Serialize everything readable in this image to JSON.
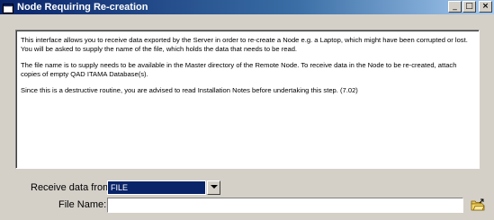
{
  "window": {
    "title": "Node Requiring Re-creation",
    "buttons": {
      "minimize": "_",
      "maximize": "□",
      "close": "×"
    }
  },
  "description": {
    "paragraphs": [
      "This interface allows you to receive data exported by the Server in order to re-create a Node e.g. a Laptop, which might have been corrupted or lost. You will be asked to supply the name of the file, which holds the data that needs to be read.",
      "The file name is to supply needs to be available in the Master directory of the Remote Node. To receive data in the Node to be re-created, attach copies of empty QAD ITAMA Database(s).",
      "Since this is a destructive routine, you are advised to read Installation Notes before undertaking this step. (7.02)"
    ]
  },
  "form": {
    "receive_label": "Receive data from:",
    "receive_value": "FILE",
    "file_label": "File Name:",
    "file_value": ""
  },
  "icons": {
    "title": "app-icon",
    "browse": "open-folder-icon",
    "dropdown": "chevron-down-icon"
  }
}
